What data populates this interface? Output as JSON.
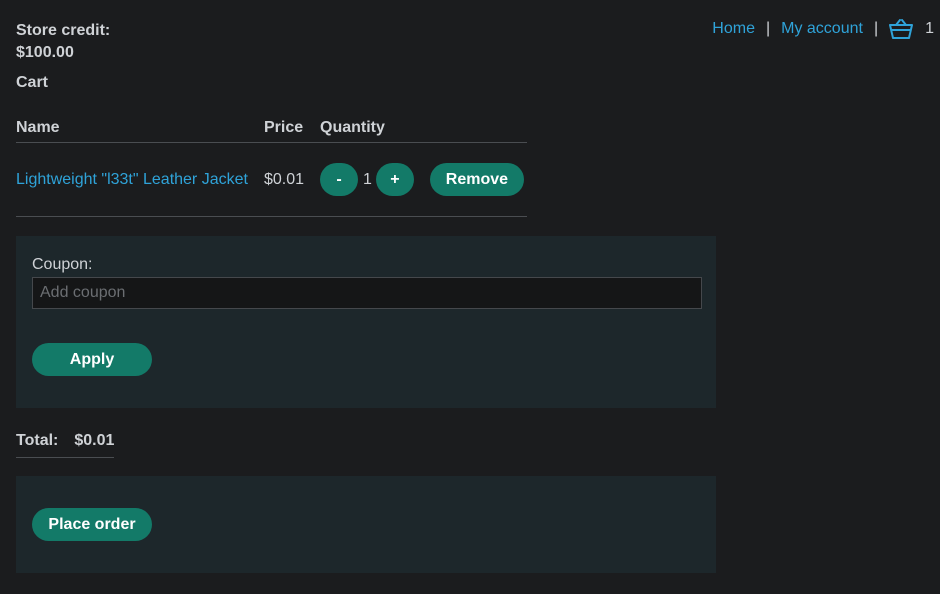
{
  "nav": {
    "home_label": "Home",
    "separator": "|",
    "account_label": "My account",
    "cart_icon": "basket-icon",
    "cart_count": "1"
  },
  "credit": {
    "label": "Store credit:",
    "value": "$100.00"
  },
  "cart": {
    "heading": "Cart",
    "columns": {
      "name": "Name",
      "price": "Price",
      "quantity": "Quantity"
    },
    "items": [
      {
        "name": "Lightweight \"l33t\" Leather Jacket",
        "price": "$0.01",
        "decrement_label": "-",
        "quantity": "1",
        "increment_label": "+",
        "remove_label": "Remove"
      }
    ]
  },
  "coupon": {
    "label": "Coupon:",
    "placeholder": "Add coupon",
    "value": "",
    "apply_label": "Apply"
  },
  "total": {
    "label": "Total:",
    "value": "$0.01"
  },
  "order": {
    "place_label": "Place order"
  },
  "colors": {
    "background": "#1b1c1e",
    "link": "#2fa3d9",
    "button": "#137a68",
    "panel": "#1d272b"
  }
}
